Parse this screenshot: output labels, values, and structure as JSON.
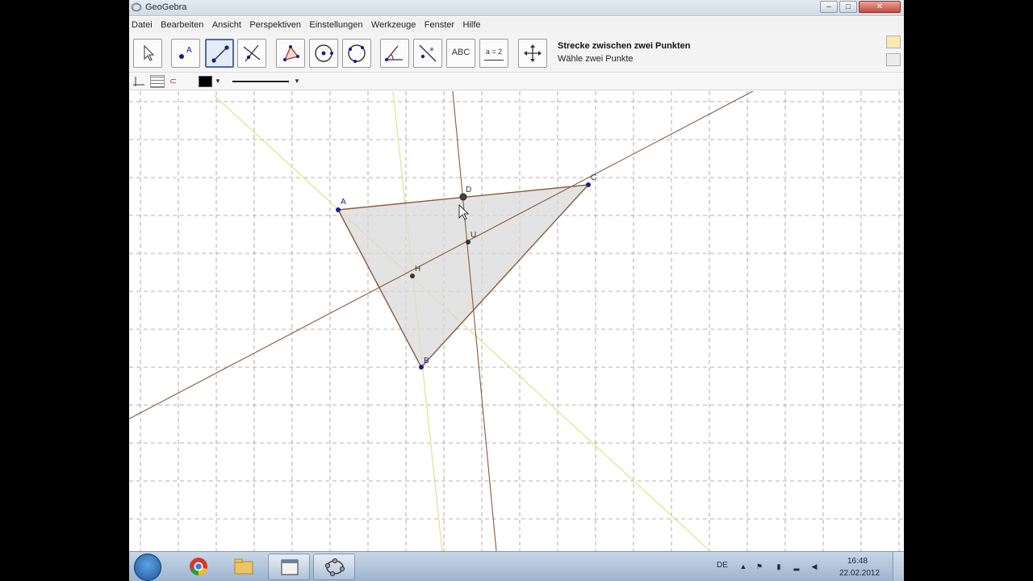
{
  "window": {
    "title": "GeoGebra",
    "controls": {
      "minimize": "–",
      "maximize": "□",
      "close": "✕"
    }
  },
  "menu": [
    "Datei",
    "Bearbeiten",
    "Ansicht",
    "Perspektiven",
    "Einstellungen",
    "Werkzeuge",
    "Fenster",
    "Hilfe"
  ],
  "toolbar": {
    "tools": [
      {
        "name": "move",
        "icon": "pointer-arrow-icon"
      },
      {
        "name": "new-point",
        "icon": "point-icon",
        "text": "A"
      },
      {
        "name": "segment",
        "icon": "segment-icon",
        "active": true
      },
      {
        "name": "perpendicular-line",
        "icon": "perpendicular-icon"
      },
      {
        "name": "polygon",
        "icon": "polygon-icon"
      },
      {
        "name": "circle-center-point",
        "icon": "circle-icon"
      },
      {
        "name": "circle-3-points",
        "icon": "circle-3-points-icon"
      },
      {
        "name": "angle",
        "icon": "angle-icon"
      },
      {
        "name": "reflect",
        "icon": "reflect-icon"
      },
      {
        "name": "text",
        "icon": "text-icon",
        "text": "ABC"
      },
      {
        "name": "slider",
        "icon": "slider-icon",
        "text": "a = 2"
      },
      {
        "name": "move-graphics-view",
        "icon": "move-cross-icon"
      }
    ],
    "help_title": "Strecke zwischen zwei Punkten",
    "help_text": "Wähle zwei Punkte"
  },
  "stylebar": {
    "color": "#000000",
    "capture_label": "⊂"
  },
  "graphics": {
    "points": {
      "A": "A",
      "B": "B",
      "C": "C",
      "D": "D",
      "U": "U",
      "H": "H"
    },
    "colors": {
      "grid": "#9a9a9a",
      "triangle_fill": "#d9d9d9",
      "triangle_edge": "#8a5a3a",
      "line": "#8a5a3a",
      "yellow_line": "#e6e08c",
      "point": "#1a1a8c"
    }
  },
  "taskbar": {
    "apps": [
      "start-button",
      "chrome",
      "explorer",
      "folder",
      "geogebra"
    ],
    "tray_lang": "DE",
    "time": "16:48",
    "date": "22.02.2012"
  }
}
